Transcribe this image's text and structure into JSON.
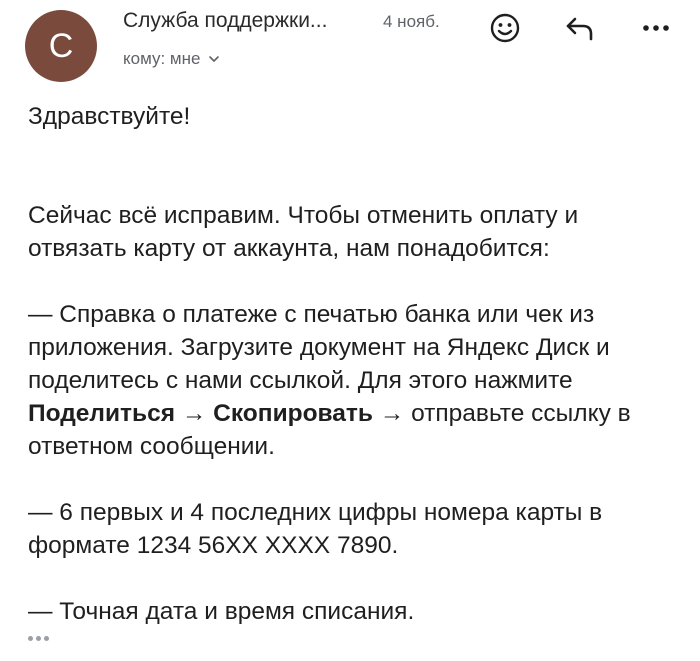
{
  "header": {
    "avatar_letter": "C",
    "avatar_color": "#7a4b3d",
    "sender": "Служба поддержки...",
    "date": "4 нояб.",
    "recipient": "кому: мне",
    "icons": [
      "emoji-icon",
      "reply-icon",
      "more-icon"
    ]
  },
  "body": {
    "greeting": "Здравствуйте!",
    "intro": "Сейчас всё исправим. Чтобы отменить оплату и отвязать карту от аккаунта, нам понадобится:",
    "item1_text": "— Справка о платеже с печатью банка или чек из приложения. Загрузите документ на Яндекс Диск и поделитесь с нами ссылкой. Для этого нажмите ",
    "item1_bold1": "Поделиться",
    "item1_arrow1": " → ",
    "item1_bold2": "Скопировать",
    "item1_tail": " → отправьте ссылку в ответном сообщении.",
    "item2": "— 6 первых и 4 последних цифры номера карты в формате 1234 56XX XXXX 7890.",
    "item3": "— Точная дата и время списания."
  }
}
